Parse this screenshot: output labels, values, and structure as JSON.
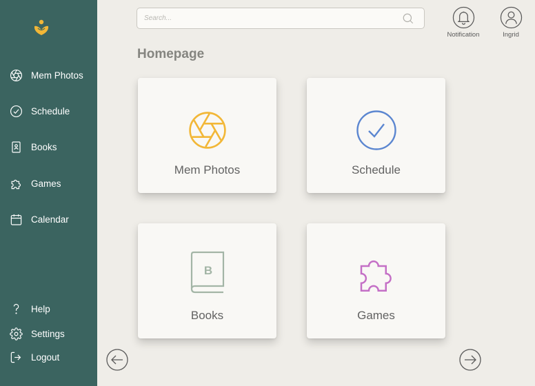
{
  "sidebar": {
    "nav": [
      {
        "label": "Mem Photos",
        "icon": "aperture-icon"
      },
      {
        "label": "Schedule",
        "icon": "check-circle-icon"
      },
      {
        "label": "Books",
        "icon": "book-icon"
      },
      {
        "label": "Games",
        "icon": "puzzle-icon"
      },
      {
        "label": "Calendar",
        "icon": "calendar-icon"
      }
    ],
    "bottom": [
      {
        "label": "Help",
        "icon": "question-icon"
      },
      {
        "label": "Settings",
        "icon": "gear-icon"
      },
      {
        "label": "Logout",
        "icon": "logout-icon"
      }
    ]
  },
  "search": {
    "placeholder": "Search..."
  },
  "header": {
    "notification_label": "Notification",
    "user_label": "Ingrid"
  },
  "page": {
    "title": "Homepage"
  },
  "cards": [
    {
      "label": "Mem Photos",
      "icon": "aperture-icon",
      "color": "#f2b737"
    },
    {
      "label": "Schedule",
      "icon": "check-circle-icon",
      "color": "#5b86d0"
    },
    {
      "label": "Books",
      "icon": "book-b-icon",
      "color": "#a3b5a6"
    },
    {
      "label": "Games",
      "icon": "puzzle-icon",
      "color": "#c46fc6"
    }
  ],
  "colors": {
    "sidebar": "#3b6460",
    "background": "#efede8",
    "logo": "#f2b737"
  }
}
